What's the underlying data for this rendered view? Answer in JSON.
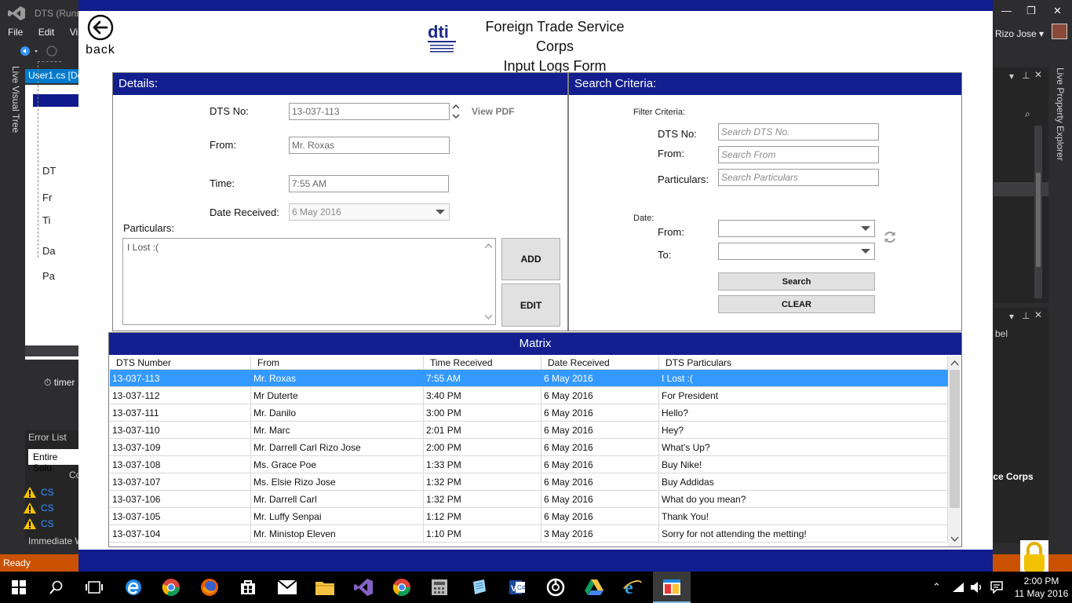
{
  "ide": {
    "title": "DTS (Runn",
    "menu": [
      "File",
      "Edit",
      "Vi"
    ],
    "doc_tab": "User1.cs [De",
    "left_vertical": "Live Visual Tree",
    "right_vertical": "Live Property Explorer",
    "doc_labels": [
      "DT",
      "Fr",
      "Ti",
      "Da",
      "Pa"
    ],
    "timer": "timer",
    "error_list_title": "Error List",
    "error_list_scope": "Entire Solu",
    "error_col": "Co",
    "errors": [
      "CS",
      "CS",
      "CS"
    ],
    "immediate": "Immediate W",
    "status": "Ready",
    "user": "Rizo Jose",
    "right_label_bel": "bel",
    "right_corps": "ice Corps"
  },
  "app": {
    "back_label": "back",
    "title_line1": "Foreign Trade Service Corps",
    "title_line2": "Input Logs Form",
    "logo_text": "dti",
    "details": {
      "heading": "Details:",
      "dts_no_label": "DTS No:",
      "dts_no_value": "13-037-113",
      "view_pdf": "View PDF",
      "from_label": "From:",
      "from_value": "Mr. Roxas",
      "time_label": "Time:",
      "time_value": "7:55 AM",
      "date_label": "Date Received:",
      "date_value": "6 May 2016",
      "particulars_label": "Particulars:",
      "particulars_value": "I Lost :(",
      "add_button": "ADD",
      "edit_button": "EDIT"
    },
    "search": {
      "heading": "Search Criteria:",
      "filter_label": "Filter Criteria:",
      "dts_no_label": "DTS No:",
      "dts_no_placeholder": "Search DTS No.",
      "from_label": "From:",
      "from_placeholder": "Search From",
      "particulars_label": "Particulars:",
      "particulars_placeholder": "Search Particulars",
      "date_label": "Date:",
      "date_from_label": "From:",
      "date_from_value": "",
      "date_to_label": "To:",
      "date_to_value": "",
      "search_button": "Search",
      "clear_button": "CLEAR"
    },
    "matrix": {
      "heading": "Matrix",
      "columns": [
        "DTS Number",
        "From",
        "Time Received",
        "Date Received",
        "DTS Particulars"
      ],
      "rows": [
        [
          "13-037-113",
          "Mr. Roxas",
          "7:55 AM",
          "6 May 2016",
          "I Lost :("
        ],
        [
          "13-037-112",
          "Mr Duterte",
          "3:40 PM",
          "6 May 2016",
          "For President"
        ],
        [
          "13-037-111",
          "Mr. Danilo",
          "3:00 PM",
          "6 May 2016",
          "Hello?"
        ],
        [
          "13-037-110",
          "Mr. Marc",
          "2:01 PM",
          "6 May 2016",
          "Hey?"
        ],
        [
          "13-037-109",
          "Mr. Darrell Carl Rizo Jose",
          "2:00 PM",
          "6 May 2016",
          "What's Up?"
        ],
        [
          "13-037-108",
          "Ms. Grace Poe",
          "1:33 PM",
          "6 May 2016",
          "Buy Nike!"
        ],
        [
          "13-037-107",
          "Ms. Elsie Rizo Jose",
          "1:32 PM",
          "6 May 2016",
          "Buy Addidas"
        ],
        [
          "13-037-106",
          "Mr. Darrell Carl",
          "1:32 PM",
          "6 May 2016",
          "What do you mean?"
        ],
        [
          "13-037-105",
          "Mr. Luffy Senpai",
          "1:12 PM",
          "6 May 2016",
          "Thank You!"
        ],
        [
          "13-037-104",
          "Mr. Ministop Eleven",
          "1:10 PM",
          "3 May 2016",
          "Sorry for not attending the metting!"
        ]
      ],
      "selected_row": 0
    }
  },
  "taskbar": {
    "time": "2:00 PM",
    "date": "11 May 2016",
    "icons": [
      "start-icon",
      "search-icon",
      "task-view-icon",
      "edge-icon",
      "chrome-icon",
      "firefox-icon",
      "store-icon",
      "mail-icon",
      "file-explorer-icon",
      "visual-studio-icon",
      "chrome-icon",
      "calculator-icon",
      "notepad-icon",
      "vs-code-icon",
      "media-icon",
      "drive-icon",
      "ie-icon",
      "app-icon"
    ]
  },
  "colors": {
    "header_blue": "#131e8f",
    "selection_blue": "#3399ff",
    "vs_status_orange": "#ca5100"
  }
}
